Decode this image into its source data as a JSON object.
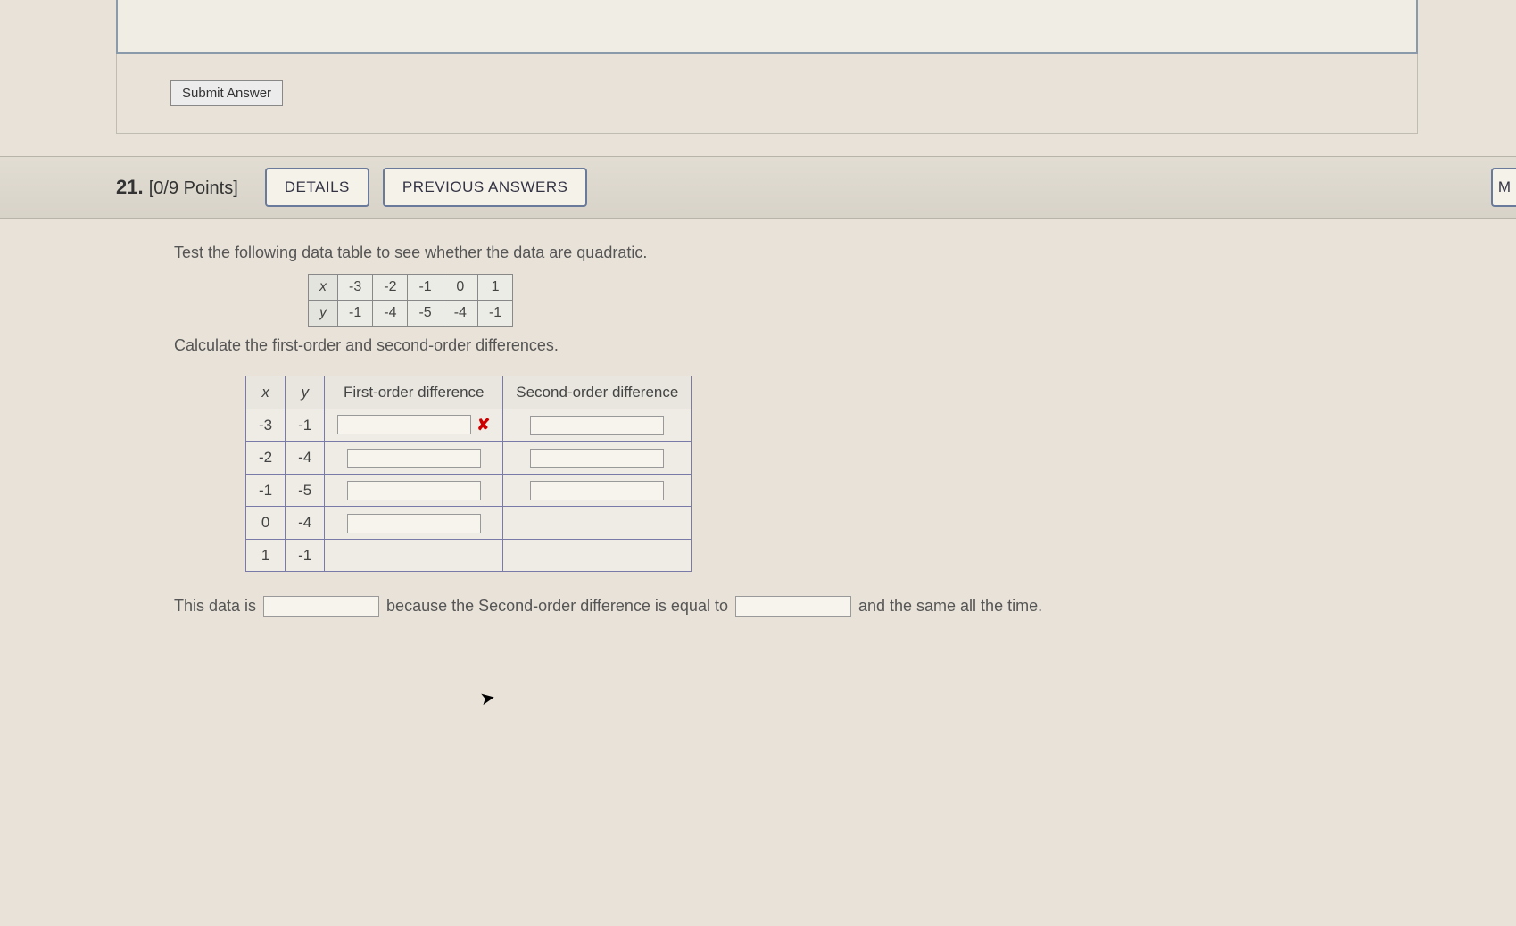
{
  "submit_label": "Submit Answer",
  "question_number": "21.",
  "points_label": "[0/9 Points]",
  "details_label": "DETAILS",
  "previous_label": "PREVIOUS ANSWERS",
  "right_stub": "M",
  "instruction1": "Test the following data table to see whether the data are quadratic.",
  "instruction2": "Calculate the first-order and second-order differences.",
  "data_table": {
    "x_label": "x",
    "y_label": "y",
    "x_values": [
      "-3",
      "-2",
      "-1",
      "0",
      "1"
    ],
    "y_values": [
      "-1",
      "-4",
      "-5",
      "-4",
      "-1"
    ]
  },
  "answer_headers": {
    "x": "x",
    "y": "y",
    "first": "First-order difference",
    "second": "Second-order difference"
  },
  "answer_rows": [
    {
      "x": "-3",
      "y": "-1",
      "first_input": true,
      "first_wrong": true,
      "second_input": true
    },
    {
      "x": "-2",
      "y": "-4",
      "first_input": true,
      "first_wrong": false,
      "second_input": true
    },
    {
      "x": "-1",
      "y": "-5",
      "first_input": true,
      "first_wrong": false,
      "second_input": true
    },
    {
      "x": "0",
      "y": "-4",
      "first_input": true,
      "first_wrong": false,
      "second_input": false
    },
    {
      "x": "1",
      "y": "-1",
      "first_input": false,
      "first_wrong": false,
      "second_input": false
    }
  ],
  "sentence": {
    "p1": "This data is",
    "p2": "because the Second-order difference is equal to",
    "p3": "and the same all the time."
  },
  "wrong_mark": "✘"
}
